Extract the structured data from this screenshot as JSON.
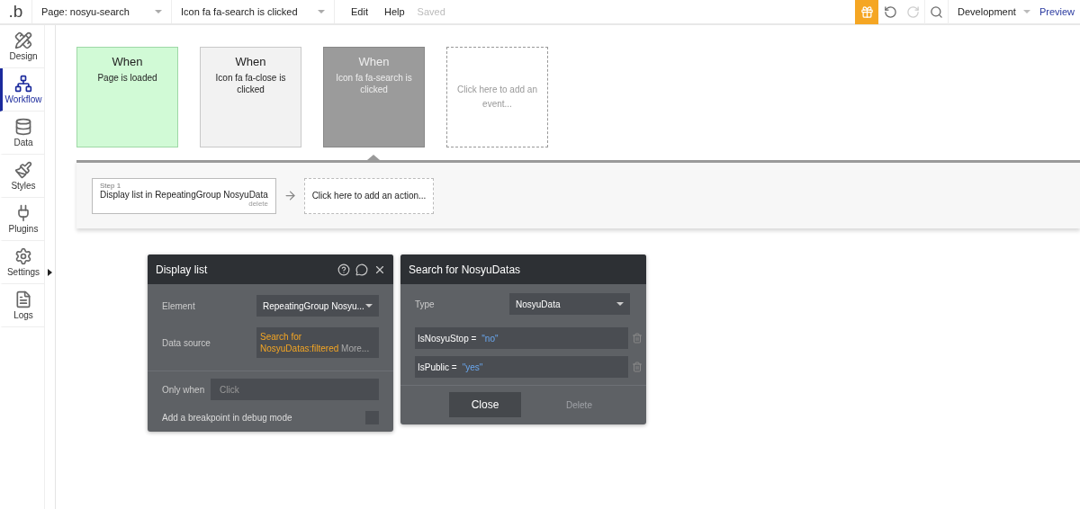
{
  "topbar": {
    "logo": ".b",
    "page_select": "Page: nosyu-search",
    "event_select": "Icon fa fa-search is clicked",
    "menu": [
      "Edit",
      "Help"
    ],
    "save_status": "Saved",
    "environment": "Development",
    "preview": "Preview"
  },
  "sidebar": {
    "items": [
      {
        "label": "Design",
        "selected": false
      },
      {
        "label": "Workflow",
        "selected": true
      },
      {
        "label": "Data",
        "selected": false
      },
      {
        "label": "Styles",
        "selected": false
      },
      {
        "label": "Plugins",
        "selected": false
      },
      {
        "label": "Settings",
        "selected": false
      },
      {
        "label": "Logs",
        "selected": false
      }
    ]
  },
  "events": [
    {
      "kind": "page",
      "heading": "When",
      "text": "Page is loaded",
      "selected": false
    },
    {
      "kind": "element",
      "heading": "When",
      "text": "Icon fa fa-close is clicked",
      "selected": false
    },
    {
      "kind": "element",
      "heading": "When",
      "text": "Icon fa fa-search is clicked",
      "selected": true
    }
  ],
  "add_event": "Click here to add an event...",
  "actions": [
    {
      "step": "Step 1",
      "text": "Display list in RepeatingGroup NosyuData",
      "delete": "delete"
    }
  ],
  "add_action": "Click here to add an action...",
  "display_panel": {
    "title": "Display list",
    "element_label": "Element",
    "element_value": "RepeatingGroup Nosyu...",
    "source_label": "Data source",
    "source_value": "Search for NosyuDatas:filtered",
    "source_more": "More...",
    "only_when_label": "Only when",
    "only_when_placeholder": "Click",
    "breakpoint_label": "Add a breakpoint in debug mode",
    "breakpoint_checked": false
  },
  "search_panel": {
    "title": "Search for NosyuDatas",
    "type_label": "Type",
    "type_value": "NosyuData",
    "constraints": [
      {
        "field": "IsNosyuStop =",
        "value": "\"no\""
      },
      {
        "field": "IsPublic =",
        "value": "\"yes\""
      }
    ],
    "close": "Close",
    "delete": "Delete"
  }
}
